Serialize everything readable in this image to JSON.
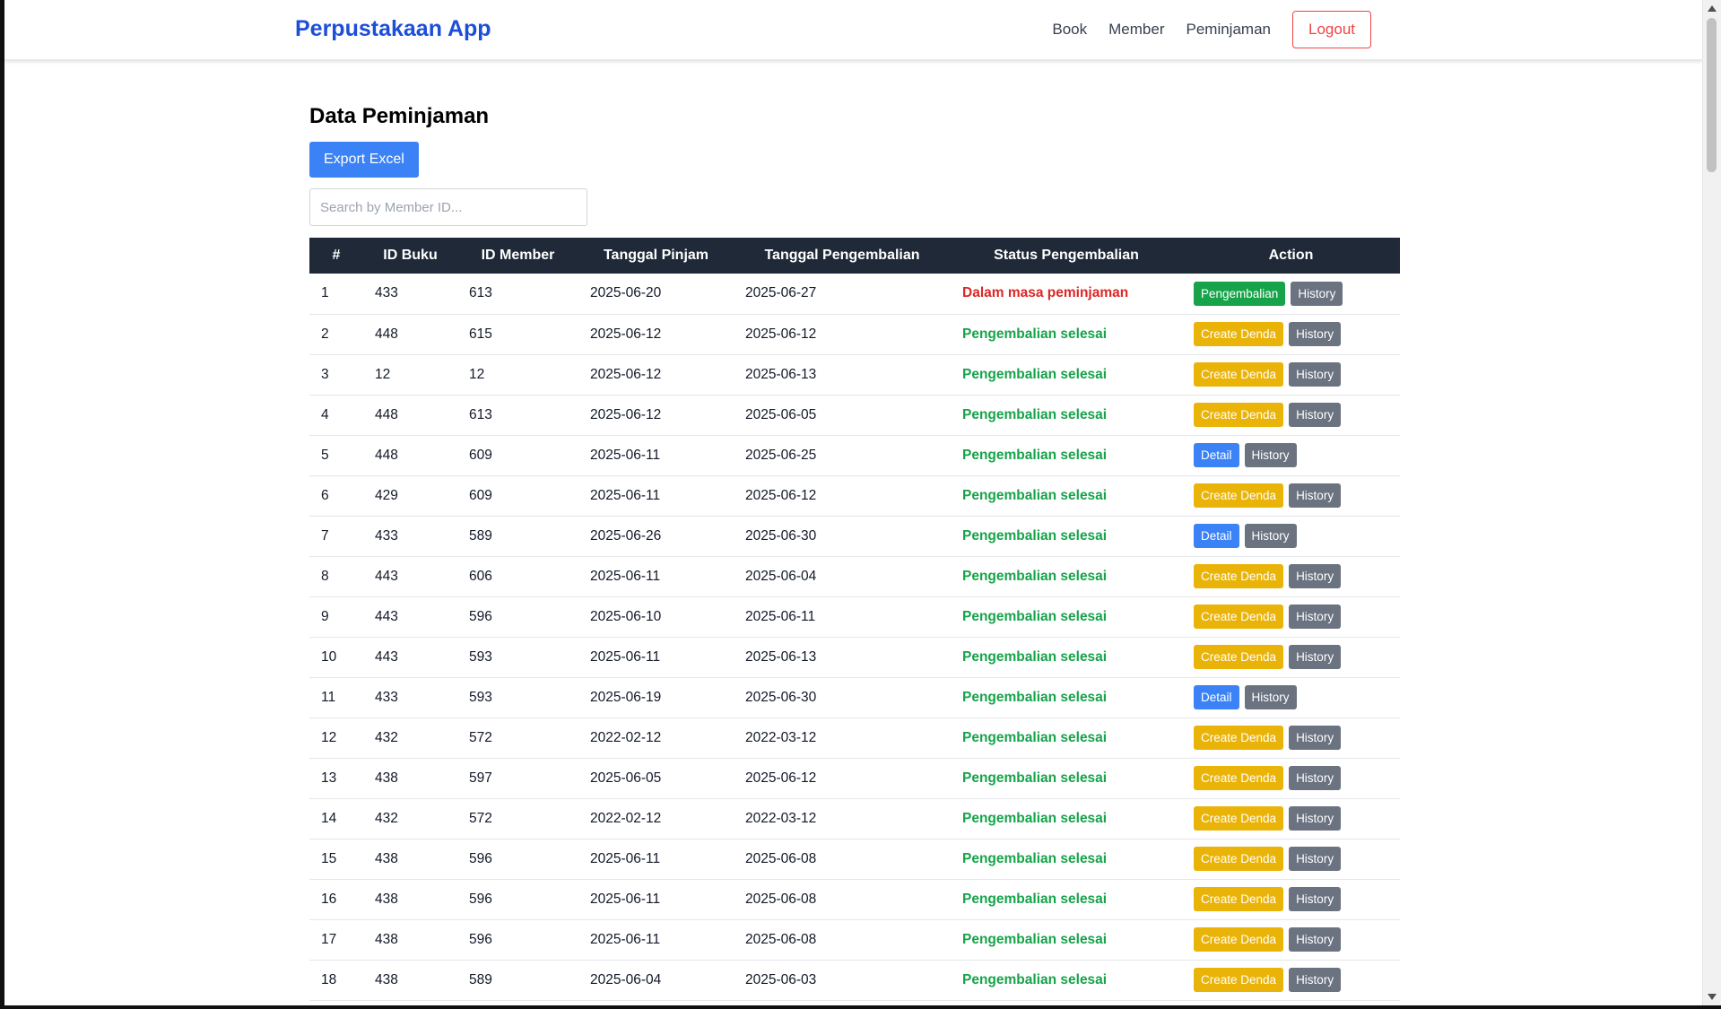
{
  "navbar": {
    "brand": "Perpustakaan App",
    "links": [
      "Book",
      "Member",
      "Peminjaman"
    ],
    "logout": "Logout"
  },
  "page": {
    "title": "Data Peminjaman",
    "export_label": "Export Excel",
    "search_placeholder": "Search by Member ID..."
  },
  "table": {
    "headers": [
      "#",
      "ID Buku",
      "ID Member",
      "Tanggal Pinjam",
      "Tanggal Pengembalian",
      "Status Pengembalian",
      "Action"
    ],
    "rows": [
      {
        "no": "1",
        "id_buku": "433",
        "id_member": "613",
        "tgl_pinjam": "2025-06-20",
        "tgl_kembali": "2025-06-27",
        "status": "Dalam masa peminjaman",
        "status_color": "#dc2626",
        "actions": [
          {
            "label": "Pengembalian",
            "color": "green"
          },
          {
            "label": "History",
            "color": "gray"
          }
        ]
      },
      {
        "no": "2",
        "id_buku": "448",
        "id_member": "615",
        "tgl_pinjam": "2025-06-12",
        "tgl_kembali": "2025-06-12",
        "status": "Pengembalian selesai",
        "status_color": "#16a34a",
        "actions": [
          {
            "label": "Create Denda",
            "color": "yellow"
          },
          {
            "label": "History",
            "color": "gray"
          }
        ]
      },
      {
        "no": "3",
        "id_buku": "12",
        "id_member": "12",
        "tgl_pinjam": "2025-06-12",
        "tgl_kembali": "2025-06-13",
        "status": "Pengembalian selesai",
        "status_color": "#16a34a",
        "actions": [
          {
            "label": "Create Denda",
            "color": "yellow"
          },
          {
            "label": "History",
            "color": "gray"
          }
        ]
      },
      {
        "no": "4",
        "id_buku": "448",
        "id_member": "613",
        "tgl_pinjam": "2025-06-12",
        "tgl_kembali": "2025-06-05",
        "status": "Pengembalian selesai",
        "status_color": "#16a34a",
        "actions": [
          {
            "label": "Create Denda",
            "color": "yellow"
          },
          {
            "label": "History",
            "color": "gray"
          }
        ]
      },
      {
        "no": "5",
        "id_buku": "448",
        "id_member": "609",
        "tgl_pinjam": "2025-06-11",
        "tgl_kembali": "2025-06-25",
        "status": "Pengembalian selesai",
        "status_color": "#16a34a",
        "actions": [
          {
            "label": "Detail",
            "color": "blue"
          },
          {
            "label": "History",
            "color": "gray"
          }
        ]
      },
      {
        "no": "6",
        "id_buku": "429",
        "id_member": "609",
        "tgl_pinjam": "2025-06-11",
        "tgl_kembali": "2025-06-12",
        "status": "Pengembalian selesai",
        "status_color": "#16a34a",
        "actions": [
          {
            "label": "Create Denda",
            "color": "yellow"
          },
          {
            "label": "History",
            "color": "gray"
          }
        ]
      },
      {
        "no": "7",
        "id_buku": "433",
        "id_member": "589",
        "tgl_pinjam": "2025-06-26",
        "tgl_kembali": "2025-06-30",
        "status": "Pengembalian selesai",
        "status_color": "#16a34a",
        "actions": [
          {
            "label": "Detail",
            "color": "blue"
          },
          {
            "label": "History",
            "color": "gray"
          }
        ]
      },
      {
        "no": "8",
        "id_buku": "443",
        "id_member": "606",
        "tgl_pinjam": "2025-06-11",
        "tgl_kembali": "2025-06-04",
        "status": "Pengembalian selesai",
        "status_color": "#16a34a",
        "actions": [
          {
            "label": "Create Denda",
            "color": "yellow"
          },
          {
            "label": "History",
            "color": "gray"
          }
        ]
      },
      {
        "no": "9",
        "id_buku": "443",
        "id_member": "596",
        "tgl_pinjam": "2025-06-10",
        "tgl_kembali": "2025-06-11",
        "status": "Pengembalian selesai",
        "status_color": "#16a34a",
        "actions": [
          {
            "label": "Create Denda",
            "color": "yellow"
          },
          {
            "label": "History",
            "color": "gray"
          }
        ]
      },
      {
        "no": "10",
        "id_buku": "443",
        "id_member": "593",
        "tgl_pinjam": "2025-06-11",
        "tgl_kembali": "2025-06-13",
        "status": "Pengembalian selesai",
        "status_color": "#16a34a",
        "actions": [
          {
            "label": "Create Denda",
            "color": "yellow"
          },
          {
            "label": "History",
            "color": "gray"
          }
        ]
      },
      {
        "no": "11",
        "id_buku": "433",
        "id_member": "593",
        "tgl_pinjam": "2025-06-19",
        "tgl_kembali": "2025-06-30",
        "status": "Pengembalian selesai",
        "status_color": "#16a34a",
        "actions": [
          {
            "label": "Detail",
            "color": "blue"
          },
          {
            "label": "History",
            "color": "gray"
          }
        ]
      },
      {
        "no": "12",
        "id_buku": "432",
        "id_member": "572",
        "tgl_pinjam": "2022-02-12",
        "tgl_kembali": "2022-03-12",
        "status": "Pengembalian selesai",
        "status_color": "#16a34a",
        "actions": [
          {
            "label": "Create Denda",
            "color": "yellow"
          },
          {
            "label": "History",
            "color": "gray"
          }
        ]
      },
      {
        "no": "13",
        "id_buku": "438",
        "id_member": "597",
        "tgl_pinjam": "2025-06-05",
        "tgl_kembali": "2025-06-12",
        "status": "Pengembalian selesai",
        "status_color": "#16a34a",
        "actions": [
          {
            "label": "Create Denda",
            "color": "yellow"
          },
          {
            "label": "History",
            "color": "gray"
          }
        ]
      },
      {
        "no": "14",
        "id_buku": "432",
        "id_member": "572",
        "tgl_pinjam": "2022-02-12",
        "tgl_kembali": "2022-03-12",
        "status": "Pengembalian selesai",
        "status_color": "#16a34a",
        "actions": [
          {
            "label": "Create Denda",
            "color": "yellow"
          },
          {
            "label": "History",
            "color": "gray"
          }
        ]
      },
      {
        "no": "15",
        "id_buku": "438",
        "id_member": "596",
        "tgl_pinjam": "2025-06-11",
        "tgl_kembali": "2025-06-08",
        "status": "Pengembalian selesai",
        "status_color": "#16a34a",
        "actions": [
          {
            "label": "Create Denda",
            "color": "yellow"
          },
          {
            "label": "History",
            "color": "gray"
          }
        ]
      },
      {
        "no": "16",
        "id_buku": "438",
        "id_member": "596",
        "tgl_pinjam": "2025-06-11",
        "tgl_kembali": "2025-06-08",
        "status": "Pengembalian selesai",
        "status_color": "#16a34a",
        "actions": [
          {
            "label": "Create Denda",
            "color": "yellow"
          },
          {
            "label": "History",
            "color": "gray"
          }
        ]
      },
      {
        "no": "17",
        "id_buku": "438",
        "id_member": "596",
        "tgl_pinjam": "2025-06-11",
        "tgl_kembali": "2025-06-08",
        "status": "Pengembalian selesai",
        "status_color": "#16a34a",
        "actions": [
          {
            "label": "Create Denda",
            "color": "yellow"
          },
          {
            "label": "History",
            "color": "gray"
          }
        ]
      },
      {
        "no": "18",
        "id_buku": "438",
        "id_member": "589",
        "tgl_pinjam": "2025-06-04",
        "tgl_kembali": "2025-06-03",
        "status": "Pengembalian selesai",
        "status_color": "#16a34a",
        "actions": [
          {
            "label": "Create Denda",
            "color": "yellow"
          },
          {
            "label": "History",
            "color": "gray"
          }
        ]
      }
    ]
  },
  "colors": {
    "brand": "#1d4ed8",
    "header_bg": "#1f2937",
    "export_btn": "#3b82f6",
    "logout": "#ef4444",
    "status_red": "#dc2626",
    "status_green": "#16a34a",
    "btn_yellow": "#eab308",
    "btn_gray": "#6b7280",
    "btn_green": "#16a34a",
    "btn_blue": "#3b82f6"
  }
}
